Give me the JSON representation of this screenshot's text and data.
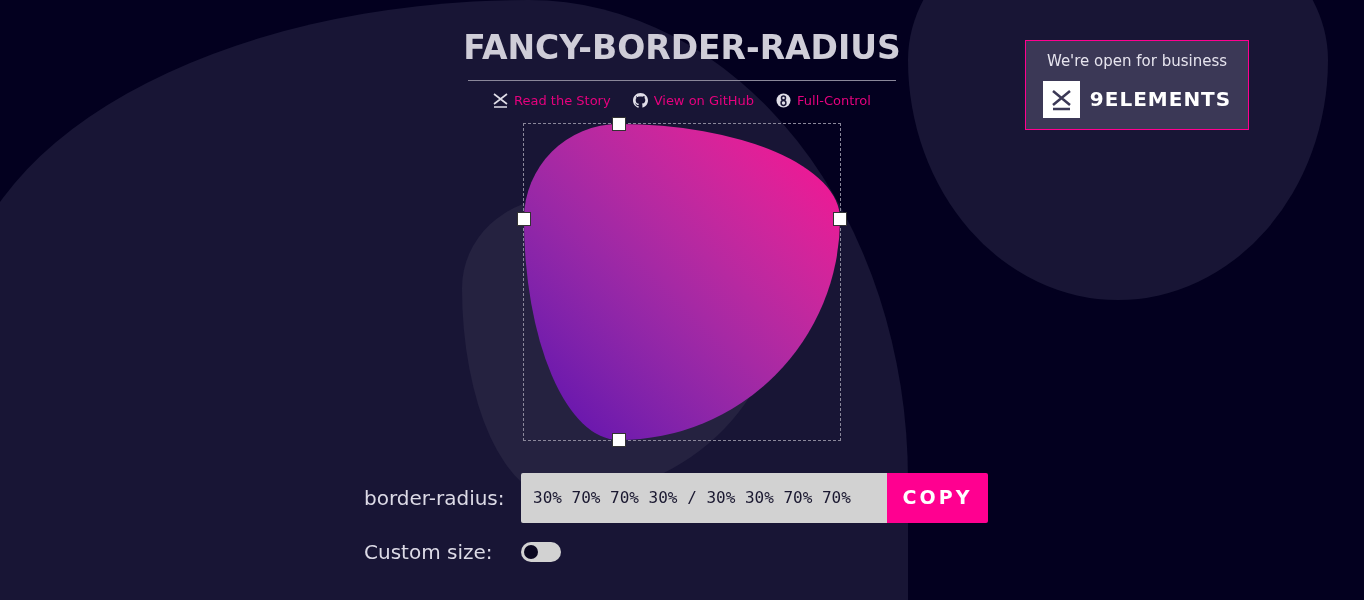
{
  "title": "FANCY-BORDER-RADIUS",
  "links": [
    {
      "kind": "story",
      "label": "Read the Story"
    },
    {
      "kind": "github",
      "label": "View on GitHub"
    },
    {
      "kind": "full",
      "label": "Full-Control"
    }
  ],
  "promo": {
    "tagline": "We're open for business",
    "brand": "9ELEMENTS"
  },
  "border_radius": {
    "label": "border-radius:",
    "value": "30% 70% 70% 30% / 30% 30% 70% 70%",
    "button": "COPY"
  },
  "custom_size": {
    "label": "Custom size:",
    "on": false
  }
}
